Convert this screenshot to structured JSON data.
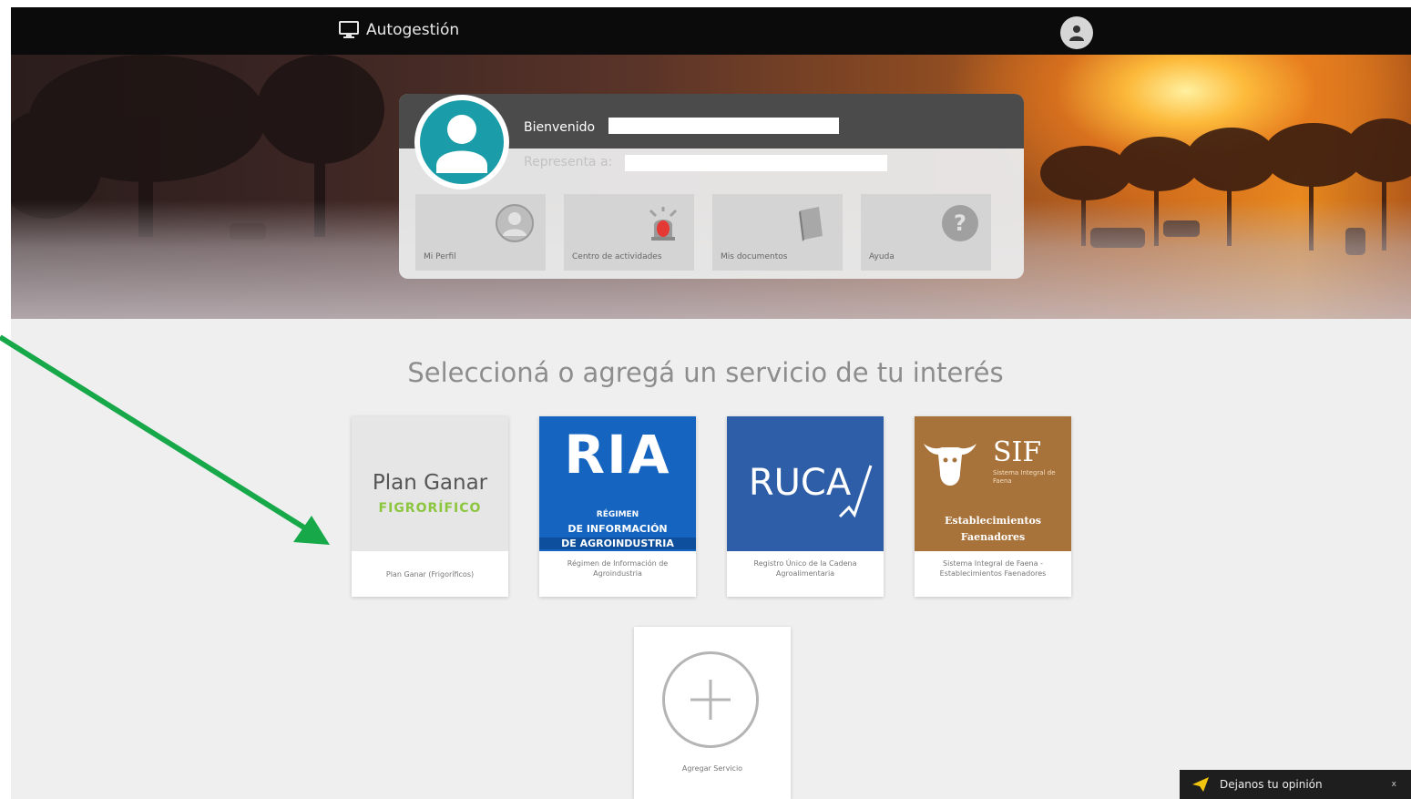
{
  "header": {
    "app_title": "Autogestión",
    "brand_icon": "monitor-icon",
    "user_icon": "user-avatar-icon"
  },
  "welcome": {
    "greeting": "Bienvenido",
    "represents_label": "Representa a:"
  },
  "quick_links": [
    {
      "label": "Mi Perfil",
      "icon": "user-circle-icon"
    },
    {
      "label": "Centro de actividades",
      "icon": "alarm-icon"
    },
    {
      "label": "Mis documentos",
      "icon": "book-icon"
    },
    {
      "label": "Ayuda",
      "icon": "question-icon"
    }
  ],
  "services_title": "Seleccioná o agregá un servicio de tu interés",
  "services": [
    {
      "logo_line1": "Plan Ganar",
      "logo_line2": "FIGRORÍFICO",
      "caption": "Plan Ganar (Frigoríficos)"
    },
    {
      "logo_title": "RIA",
      "logo_line1": "RÉGIMEN",
      "logo_line2": "DE INFORMACIÓN",
      "logo_line3": "DE AGROINDUSTRIA",
      "caption": "Régimen de Información de Agroindustria"
    },
    {
      "logo_title": "RUCA",
      "caption": "Registro Único de la Cadena Agroalimentaria"
    },
    {
      "logo_title": "SIF",
      "logo_sub": "Sistema Integral de Faena",
      "logo_line1": "Establecimientos",
      "logo_line2": "Faenadores",
      "caption": "Sistema Integral de Faena - Establecimientos Faenadores"
    }
  ],
  "add_service_label": "Agregar Servicio",
  "feedback": {
    "label": "Dejanos tu opinión",
    "close": "x"
  },
  "colors": {
    "topbar": "#0b0b0b",
    "avatar_teal": "#1a9da8",
    "ria_blue": "#1565c0",
    "ruca_blue": "#2f5ea8",
    "sif_brown": "#a8733a",
    "plan_green": "#8cc63f",
    "arrow_green": "#17a84a"
  }
}
